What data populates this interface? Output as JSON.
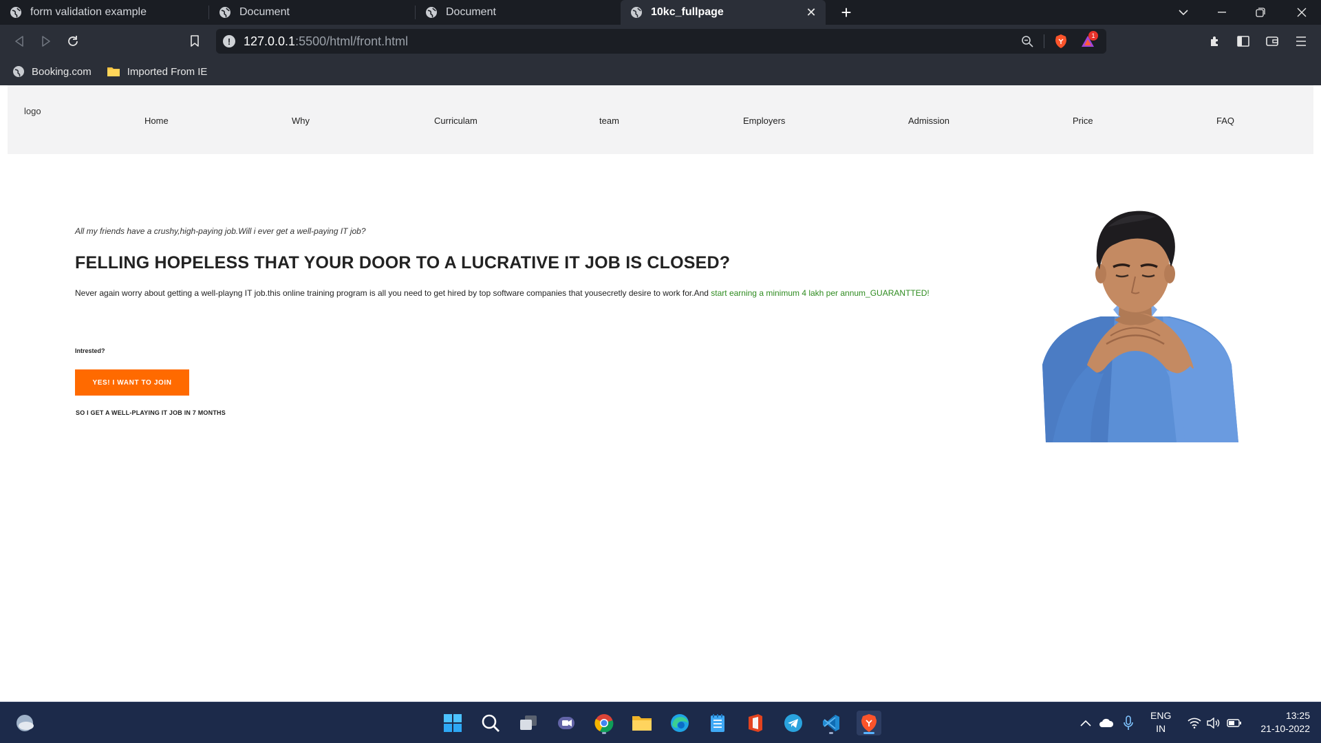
{
  "browser": {
    "tabs": [
      {
        "title": "form validation example",
        "active": false
      },
      {
        "title": "Document",
        "active": false
      },
      {
        "title": "Document",
        "active": false
      },
      {
        "title": "10kc_fullpage",
        "active": true
      }
    ],
    "url_host": "127.0.0.1",
    "url_path": ":5500/html/front.html",
    "shields_badge": "1",
    "bookmarks": [
      {
        "label": "Booking.com",
        "icon": "globe-icon"
      },
      {
        "label": "Imported From IE",
        "icon": "folder-icon"
      }
    ]
  },
  "page": {
    "logo_alt": "logo",
    "nav": [
      "Home",
      "Why",
      "Curriculam",
      "team",
      "Employers",
      "Admission",
      "Price",
      "FAQ"
    ],
    "kicker": "All my friends have a crushy,high-paying job.Will i ever get a well-paying IT job?",
    "title": "FELLING HOPELESS THAT YOUR DOOR TO A LUCRATIVE IT JOB IS CLOSED?",
    "text_plain": "Never again worry about getting a well-playng IT job.this online training program is all you need to get hired by top software companies that yousecretly desire to work for.And ",
    "text_green": "start earning a minimum 4 lakh per annum_GUARANTTED!",
    "intrested": "Intrested?",
    "join_button": "YES! I WANT TO JOIN",
    "join_sub": "SO I GET A WELL-PLAYING IT JOB IN 7 MONTHS",
    "green_color": "#2e8b1f",
    "button_color": "#ff6a00"
  },
  "taskbar": {
    "lang_top": "ENG",
    "lang_bottom": "IN",
    "time": "13:25",
    "date": "21-10-2022"
  }
}
